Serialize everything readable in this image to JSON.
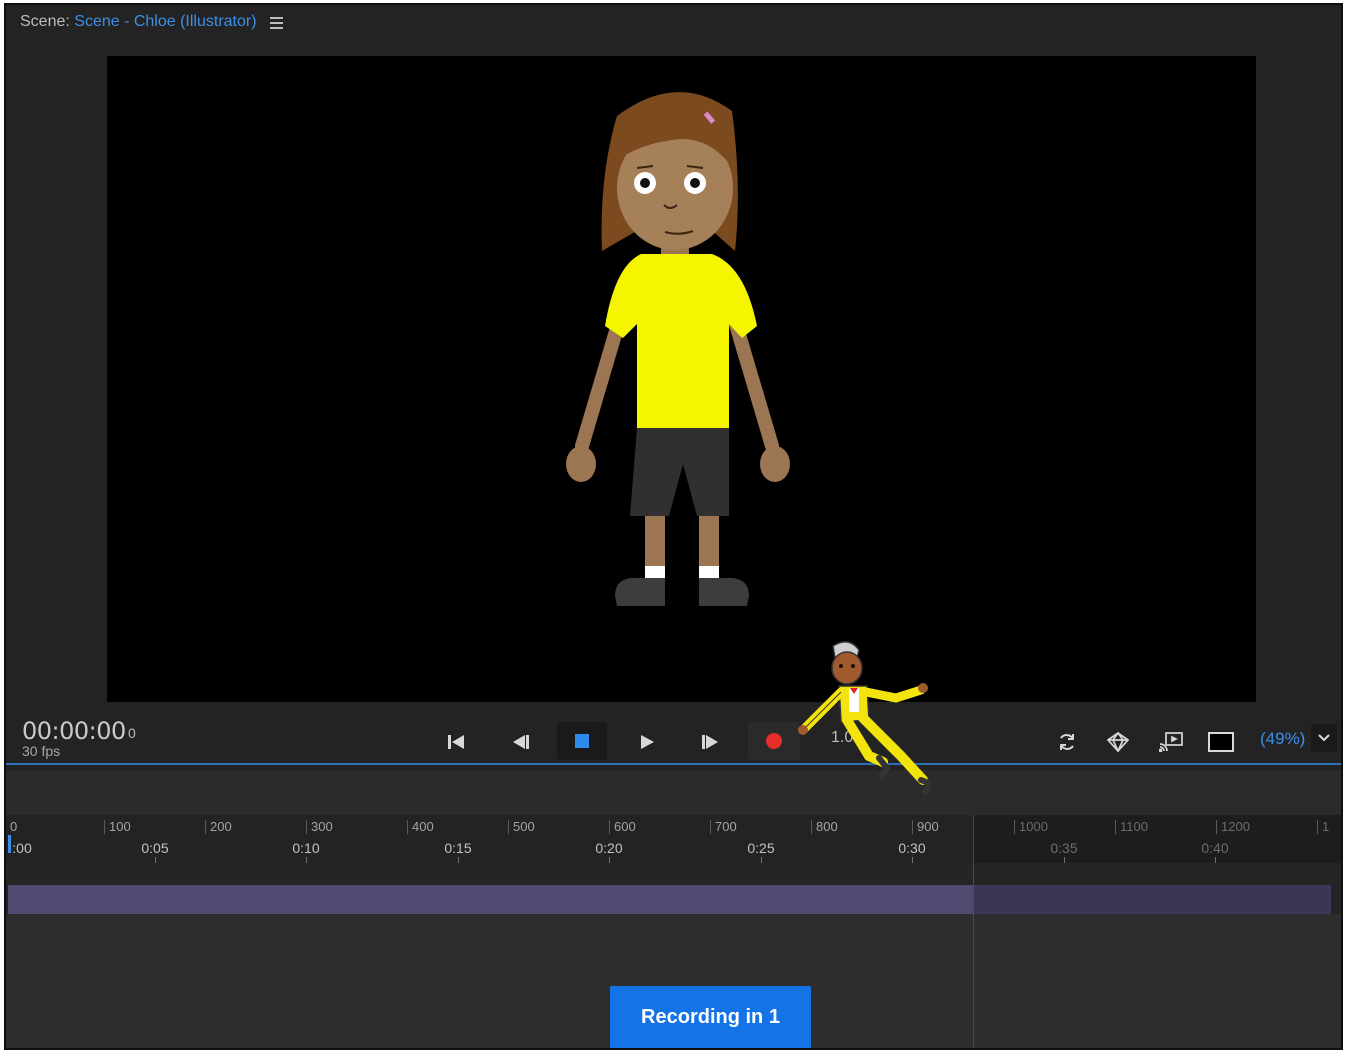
{
  "scene": {
    "prefix": "Scene:",
    "name": "Scene - Chloe (Illustrator)",
    "menu_icon": "hamburger-menu-icon"
  },
  "transport": {
    "timecode": "00:00:00",
    "frame": "0",
    "fps": "30 fps",
    "speed": "1.0",
    "buttons": [
      "go-to-start-icon",
      "step-back-icon",
      "stop-icon",
      "play-icon",
      "step-forward-icon",
      "record-icon"
    ],
    "record_color": "#e82c2c",
    "stop_color": "#2d8ceb"
  },
  "view": {
    "icons": [
      "loop-icon",
      "stage-icon",
      "cast-icon",
      "fit-frame-icon",
      "chevron-down-icon"
    ],
    "zoom": "(49%)"
  },
  "ruler": {
    "frames": [
      "0",
      "100",
      "200",
      "300",
      "400",
      "500",
      "600",
      "700",
      "800",
      "900",
      "1000",
      "1100",
      "1200",
      "1"
    ],
    "times": [
      ":00",
      "0:05",
      "0:10",
      "0:15",
      "0:20",
      "0:25",
      "0:30",
      "0:35",
      "0:40"
    ]
  },
  "recording": {
    "label": "Recording in 1"
  },
  "colors": {
    "accent": "#3d8ee8",
    "panel": "#232323",
    "track": "#534a72",
    "button": "#1473e6"
  }
}
